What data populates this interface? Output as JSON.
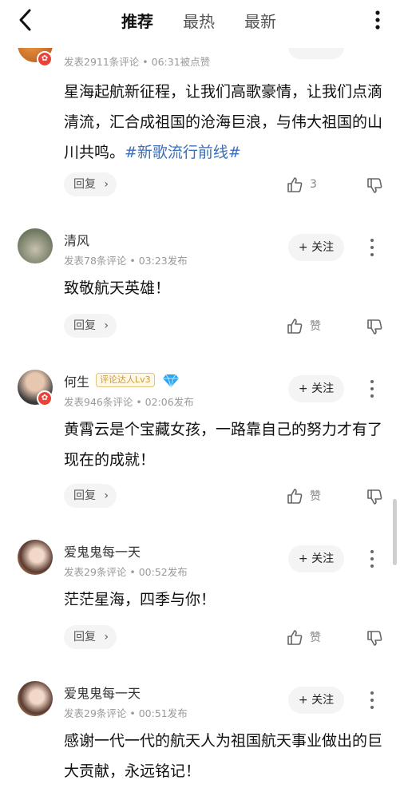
{
  "header": {
    "tabs": [
      {
        "label": "推荐",
        "active": true
      },
      {
        "label": "最热",
        "active": false
      },
      {
        "label": "最新",
        "active": false
      }
    ],
    "back_icon": "chevron-left-icon",
    "more_icon": "vertical-ellipsis-icon"
  },
  "comments": [
    {
      "meta": "发表2911条评论 • 06:31被点赞",
      "content": "星海起航新征程，让我们高歌豪情，让我们点滴清流，汇合成祖国的沧海巨浪，与伟大祖国的山川共鸣。",
      "hashtag": "#新歌流行前线#",
      "reply_label": "回复",
      "like_label": "3"
    },
    {
      "user_name": "清风",
      "meta": "发表78条评论 • 03:23发布",
      "follow_label": "+ 关注",
      "content": "致敬航天英雄！",
      "reply_label": "回复",
      "like_label": "赞"
    },
    {
      "user_name": "何生",
      "level_badge": "评论达人Lv3",
      "meta": "发表946条评论 • 02:06发布",
      "follow_label": "+ 关注",
      "content": "黄霄云是个宝藏女孩，一路靠自己的努力才有了现在的成就！",
      "reply_label": "回复",
      "like_label": "赞"
    },
    {
      "user_name": "爱鬼鬼每一天",
      "meta": "发表29条评论 • 00:52发布",
      "follow_label": "+ 关注",
      "content": "茫茫星海，四季与你！",
      "reply_label": "回复",
      "like_label": "赞"
    },
    {
      "user_name": "爱鬼鬼每一天",
      "meta": "发表29条评论 • 00:51发布",
      "follow_label": "+ 关注",
      "content": "感谢一代一代的航天人为祖国航天事业做出的巨大贡献，永远铭记！"
    }
  ],
  "colors": {
    "hashtag": "#3b6fb8",
    "badge_red": "#e8433a",
    "level_badge": "#c99a3b"
  }
}
